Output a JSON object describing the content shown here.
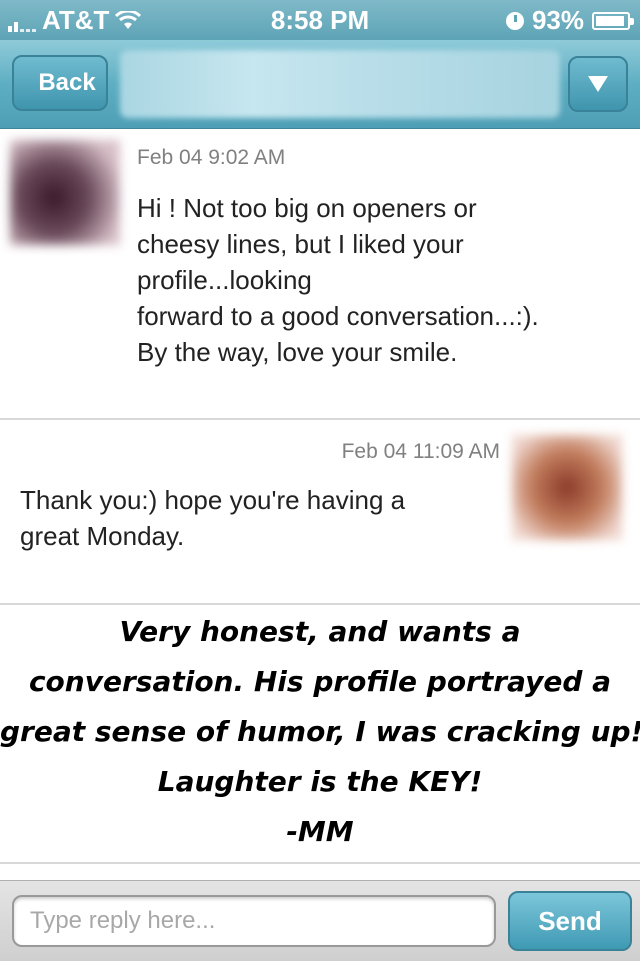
{
  "status_bar": {
    "carrier": "AT&T",
    "time": "8:58 PM",
    "battery": "93%",
    "battery_level": 0.93
  },
  "nav": {
    "back_label": "Back"
  },
  "messages": [
    {
      "timestamp": "Feb 04 9:02 AM",
      "text": "Hi ! Not too big on openers or\ncheesy lines, but I liked your\nprofile...looking\nforward to a good conversation...:).\nBy the way, love your smile."
    },
    {
      "timestamp": "Feb 04 11:09 AM",
      "text": "Thank you:) hope you're having a\ngreat Monday."
    }
  ],
  "note": {
    "lines": [
      "Very honest, and wants a",
      "conversation. His profile portrayed a",
      "great sense of humor, I was cracking up!",
      "Laughter is the KEY!",
      "-MM"
    ]
  },
  "reply": {
    "placeholder": "Type reply here...",
    "send_label": "Send"
  },
  "colors": {
    "nav_accent": "#5eaec3",
    "button_border": "#3a8297"
  }
}
